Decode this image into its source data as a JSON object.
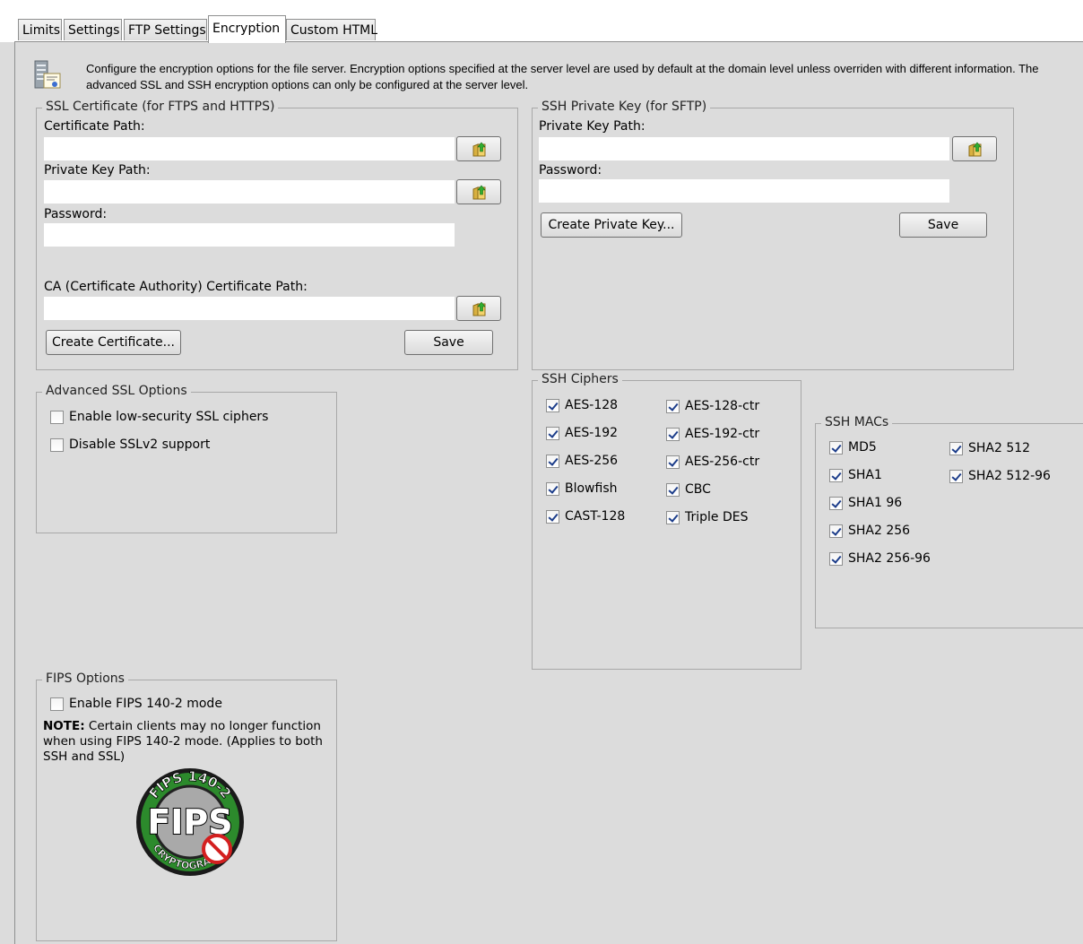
{
  "tabs": [
    {
      "label": "Limits",
      "active": false
    },
    {
      "label": "Settings",
      "active": false
    },
    {
      "label": "FTP Settings",
      "active": false
    },
    {
      "label": "Encryption",
      "active": true
    },
    {
      "label": "Custom HTML",
      "active": false
    }
  ],
  "description": "Configure the encryption options for the file server. Encryption options specified at the server level are used by default at the domain level unless overriden with different information. The advanced SSL and SSH encryption options can only be configured at the server level.",
  "ssl_certificate": {
    "title": "SSL Certificate (for FTPS and HTTPS)",
    "certificate_path_label": "Certificate Path:",
    "certificate_path_value": "",
    "private_key_path_label": "Private Key Path:",
    "private_key_path_value": "",
    "password_label": "Password:",
    "password_value": "",
    "ca_path_label": "CA (Certificate Authority) Certificate Path:",
    "ca_path_value": "",
    "create_button": "Create Certificate...",
    "save_button": "Save"
  },
  "ssh_private_key": {
    "title": "SSH Private Key (for SFTP)",
    "private_key_path_label": "Private Key Path:",
    "private_key_path_value": "",
    "password_label": "Password:",
    "password_value": "",
    "create_button": "Create Private Key...",
    "save_button": "Save"
  },
  "advanced_ssl": {
    "title": "Advanced SSL Options",
    "options": [
      {
        "label": "Enable low-security SSL ciphers",
        "checked": false
      },
      {
        "label": "Disable SSLv2 support",
        "checked": false
      }
    ]
  },
  "ssh_ciphers": {
    "title": "SSH Ciphers",
    "col1": [
      {
        "label": "AES-128",
        "checked": true
      },
      {
        "label": "AES-192",
        "checked": true
      },
      {
        "label": "AES-256",
        "checked": true
      },
      {
        "label": "Blowfish",
        "checked": true
      },
      {
        "label": "CAST-128",
        "checked": true
      }
    ],
    "col2": [
      {
        "label": "AES-128-ctr",
        "checked": true
      },
      {
        "label": "AES-192-ctr",
        "checked": true
      },
      {
        "label": "AES-256-ctr",
        "checked": true
      },
      {
        "label": "CBC",
        "checked": true
      },
      {
        "label": "Triple DES",
        "checked": true
      }
    ]
  },
  "ssh_macs": {
    "title": "SSH MACs",
    "col1": [
      {
        "label": "MD5",
        "checked": true
      },
      {
        "label": "SHA1",
        "checked": true
      },
      {
        "label": "SHA1 96",
        "checked": true
      },
      {
        "label": "SHA2 256",
        "checked": true
      },
      {
        "label": "SHA2 256-96",
        "checked": true
      }
    ],
    "col2": [
      {
        "label": "SHA2 512",
        "checked": true
      },
      {
        "label": "SHA2 512-96",
        "checked": true
      }
    ]
  },
  "fips": {
    "title": "FIPS Options",
    "option": {
      "label": "Enable FIPS 140-2 mode",
      "checked": false
    },
    "note_bold": "NOTE:",
    "note_text": " Certain clients may no longer function when using FIPS 140-2 mode. (Applies to both SSH and SSL)",
    "logo_text_main": "FIPS",
    "logo_text_top": "FIPS 140-2",
    "logo_text_bottom": "CRYPTOGRAPHY"
  },
  "colors": {
    "background": "#dcdcdc",
    "border": "#a8a8a8",
    "check": "#1c3d8a",
    "logo_red": "#d42020"
  }
}
